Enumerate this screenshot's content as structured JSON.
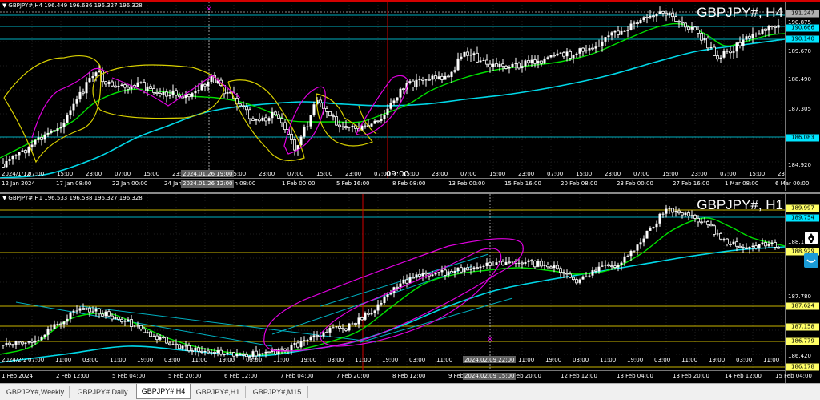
{
  "colors": {
    "bg": "#000000",
    "grid": "#1e1e1e",
    "candle": "#ffffff",
    "ma_fast": "#00e000",
    "ma_slow": "#00d8e8",
    "yellow_drawing": "#d8d000",
    "magenta_drawing": "#e000e0",
    "cyan_hline": "#00b0c0",
    "yellow_hline": "#c8b400",
    "active_window_border": "#d40000"
  },
  "h4": {
    "header": "GBPJPY#,H4  196.449 196.636 196.327 196.328",
    "title": "GBPJPY#, H4",
    "price_ticks": [
      "191.247",
      "190.875",
      "190.666",
      "190.140",
      "189.670",
      "188.490",
      "187.305",
      "186.083",
      "184.920"
    ],
    "highlighted_prices": [
      {
        "label": "191.247",
        "style": "gray"
      },
      {
        "label": "190.666",
        "style": "cyan"
      },
      {
        "label": "190.140",
        "style": "cyan"
      },
      {
        "label": "186.083",
        "style": "cyan"
      }
    ],
    "hours_row": [
      "07:00",
      "15:00",
      "23:00",
      "07:00",
      "15:00",
      "23:00",
      "07:00",
      "15:00",
      "23:00",
      "07:00",
      "15:00",
      "23:00",
      "07:00",
      "15:00",
      "23:00",
      "07:00",
      "15:00",
      "23:00",
      "07:00",
      "15:00",
      "23:00",
      "07:00",
      "15:00",
      "23:00",
      "07:00",
      "15:00",
      "23:00"
    ],
    "dates_row": [
      "12 Jan 2024",
      "17 Jan 08:00",
      "22 Jan 00:00",
      "24 Jan 16:00",
      "29 Jan 08:00",
      "1 Feb 00:00",
      "5 Feb 16:00",
      "8 Feb 08:00",
      "13 Feb 00:00",
      "15 Feb 16:00",
      "20 Feb 08:00",
      "23 Feb 00:00",
      "27 Feb 16:00",
      "1 Mar 08:00",
      "6 Mar 00:00"
    ],
    "first_label": "2024/1/12",
    "crosshair_labels": [
      "2024.01.26 19:00",
      "2024.01.26 12:00"
    ],
    "cursor_time": "09:00"
  },
  "h1": {
    "header": "GBPJPY#,H1  196.533 196.588 196.327 196.328",
    "title": "GBPJPY#, H1",
    "price_ticks": [
      "189.997",
      "189.754",
      "188.929",
      "188.1",
      "187.780",
      "187.624",
      "187.158",
      "186.779",
      "186.420",
      "186.178"
    ],
    "highlighted_prices": [
      {
        "label": "189.997",
        "style": "yellow"
      },
      {
        "label": "189.754",
        "style": "cyan"
      },
      {
        "label": "188.929",
        "style": "yellow"
      },
      {
        "label": "187.624",
        "style": "yellow"
      },
      {
        "label": "187.158",
        "style": "yellow"
      },
      {
        "label": "186.779",
        "style": "yellow"
      },
      {
        "label": "186.178",
        "style": "yellow"
      }
    ],
    "hours_row": [
      "07:00",
      "11:00",
      "03:00",
      "11:00",
      "19:00",
      "03:00",
      "11:00",
      "19:00",
      "03:00",
      "11:00",
      "19:00",
      "03:00",
      "11:00",
      "19:00",
      "03:00",
      "11:00",
      "19:00",
      "03:00",
      "11:00",
      "19:00",
      "03:00",
      "11:00",
      "19:00",
      "03:00",
      "11:00",
      "19:00",
      "03:00",
      "11:00"
    ],
    "dates_row": [
      "1 Feb 2024",
      "2 Feb 12:00",
      "5 Feb 04:00",
      "5 Feb 20:00",
      "6 Feb 12:00",
      "7 Feb 04:00",
      "7 Feb 20:00",
      "8 Feb 12:00",
      "9 Feb",
      "12 Feb 20:00",
      "12 Feb 12:00",
      "13 Feb 04:00",
      "13 Feb 20:00",
      "14 Feb 12:00",
      "15 Feb 04:00"
    ],
    "first_label": "2024/2/2",
    "crosshair_labels": [
      "2024.02.09 22:00",
      "2024.02.09 15:00"
    ]
  },
  "tabs": [
    {
      "label": "GBPJPY#,Weekly",
      "active": false
    },
    {
      "label": "GBPJPY#,Daily",
      "active": false
    },
    {
      "label": "GBPJPY#,H4",
      "active": true
    },
    {
      "label": "GBPJPY#,H1",
      "active": false
    },
    {
      "label": "GBPJPY#,M15",
      "active": false
    }
  ],
  "side_tools": [
    "pen-icon",
    "smile-icon"
  ]
}
